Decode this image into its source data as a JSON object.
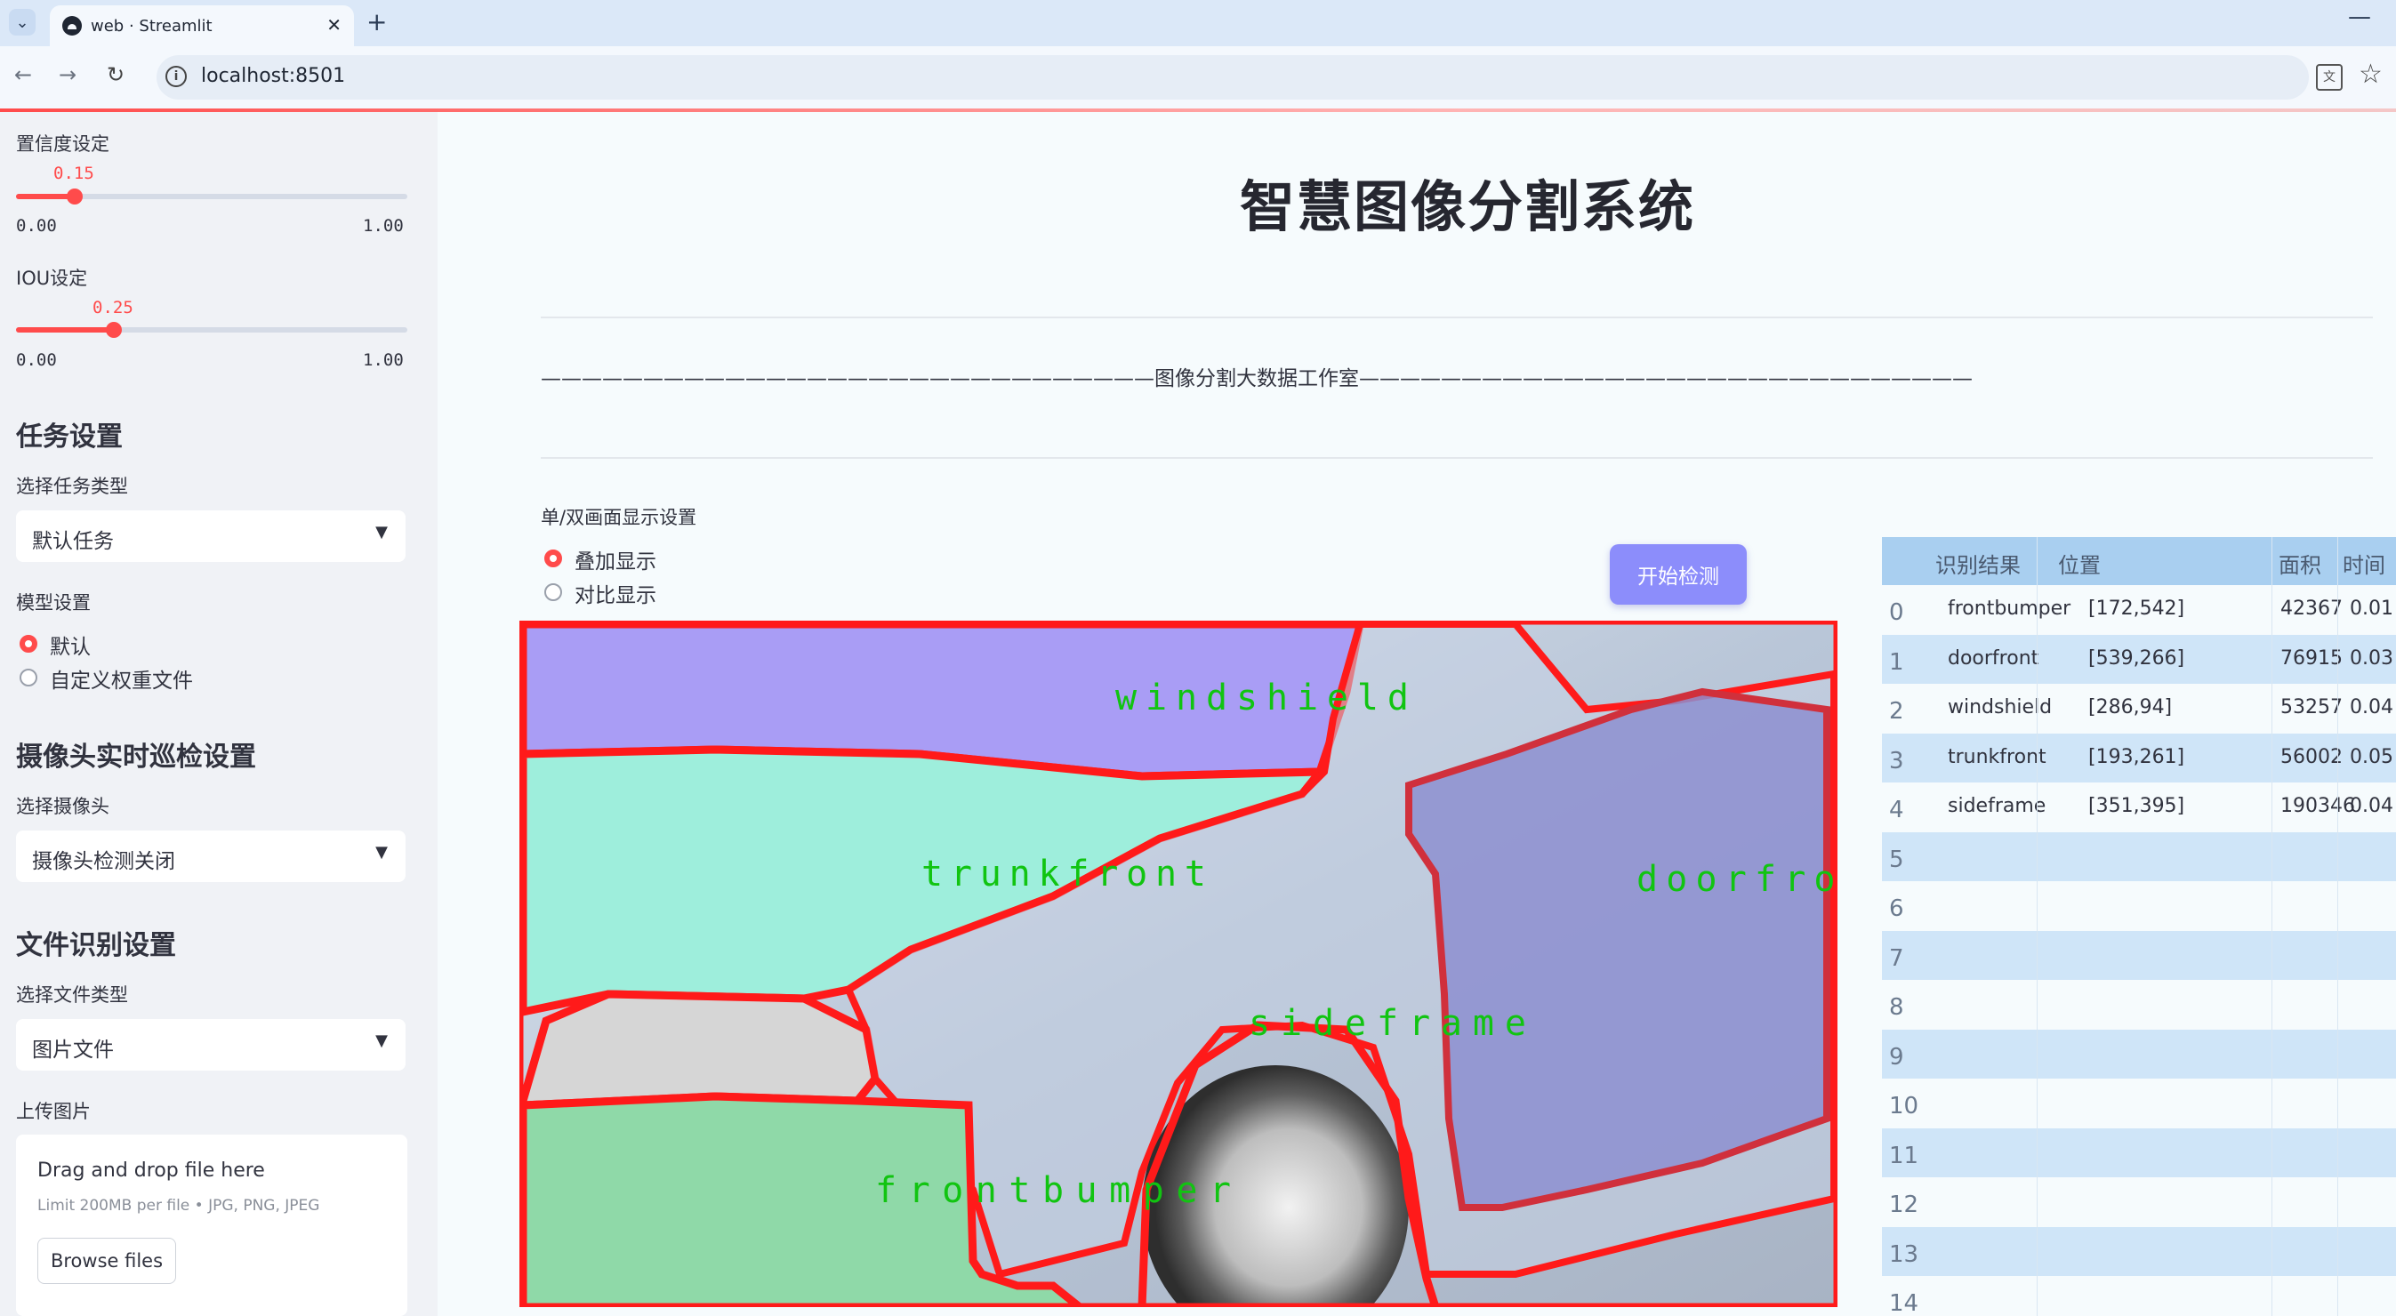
{
  "browser": {
    "tab_title": "web · Streamlit",
    "tab_close": "✕",
    "new_tab": "+",
    "url": "localhost:8501",
    "minimize": "—"
  },
  "sidebar": {
    "confidence": {
      "label": "置信度设定",
      "value": "0.15",
      "min": "0.00",
      "max": "1.00",
      "fraction": 0.15
    },
    "iou": {
      "label": "IOU设定",
      "value": "0.25",
      "min": "0.00",
      "max": "1.00",
      "fraction": 0.25
    },
    "task_heading": "任务设置",
    "task_type_label": "选择任务类型",
    "task_type_value": "默认任务",
    "model_label": "模型设置",
    "model_options": [
      "默认",
      "自定义权重文件"
    ],
    "camera_heading": "摄像头实时巡检设置",
    "camera_label": "选择摄像头",
    "camera_value": "摄像头检测关闭",
    "file_heading": "文件识别设置",
    "file_type_label": "选择文件类型",
    "file_type_value": "图片文件",
    "upload_label": "上传图片",
    "upload_drag": "Drag and drop file here",
    "upload_limit": "Limit 200MB per file • JPG, PNG, JPEG",
    "browse_button": "Browse files"
  },
  "main": {
    "title": "智慧图像分割系统",
    "banner": "——————————————————————————————图像分割大数据工作室——————————————————————————————",
    "display_label": "单/双画面显示设置",
    "display_options": [
      "叠加显示",
      "对比显示"
    ],
    "start_button": "开始检测",
    "mask_labels": [
      "windshield",
      "trunkfront",
      "doorfront",
      "sideframe",
      "frontbumper"
    ]
  },
  "table": {
    "headers": [
      "识别结果",
      "位置",
      "面积",
      "时间"
    ],
    "rows": [
      {
        "idx": "0",
        "result": "frontbumper",
        "pos": "[172,542]",
        "area": "42367",
        "time": "0.01"
      },
      {
        "idx": "1",
        "result": "doorfront",
        "pos": "[539,266]",
        "area": "76915",
        "time": "0.03"
      },
      {
        "idx": "2",
        "result": "windshield",
        "pos": "[286,94]",
        "area": "53257",
        "time": "0.04"
      },
      {
        "idx": "3",
        "result": "trunkfront",
        "pos": "[193,261]",
        "area": "56002",
        "time": "0.05"
      },
      {
        "idx": "4",
        "result": "sideframe",
        "pos": "[351,395]",
        "area": "190346",
        "time": "0.04"
      }
    ],
    "empty_indices": [
      "5",
      "6",
      "7",
      "8",
      "9",
      "10",
      "11",
      "12",
      "13",
      "14"
    ]
  },
  "colors": {
    "accent": "#ff4b4b",
    "button": "#8c8dfb",
    "table_header": "#a9cff0",
    "table_band": "#cfe5f8"
  }
}
